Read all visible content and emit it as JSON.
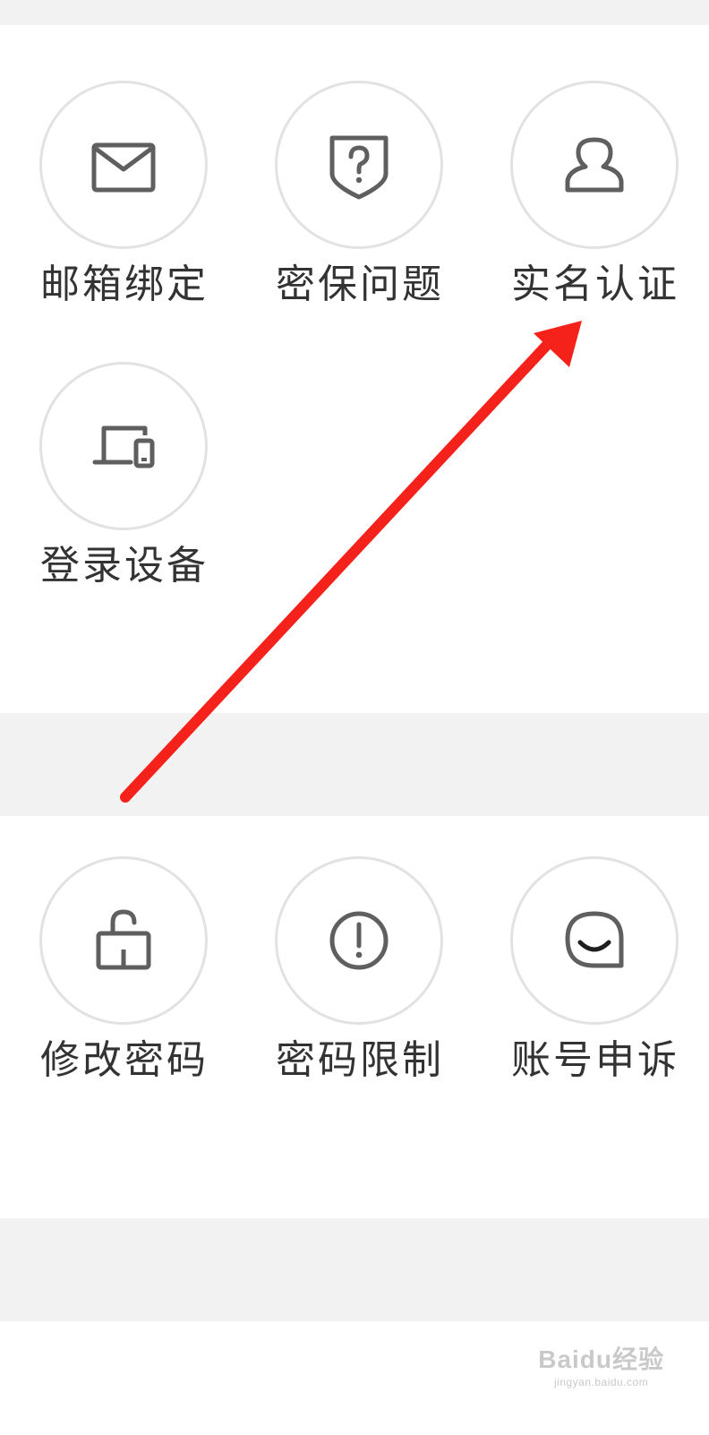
{
  "security_items": [
    {
      "label": "邮箱绑定",
      "icon": "mail-icon"
    },
    {
      "label": "密保问题",
      "icon": "shield-question-icon"
    },
    {
      "label": "实名认证",
      "icon": "user-icon"
    },
    {
      "label": "登录设备",
      "icon": "devices-icon"
    }
  ],
  "password_items": [
    {
      "label": "修改密码",
      "icon": "unlock-icon"
    },
    {
      "label": "密码限制",
      "icon": "exclamation-circle-icon"
    },
    {
      "label": "账号申诉",
      "icon": "chat-smile-icon"
    }
  ],
  "annotation": {
    "arrow_color": "#f5221b",
    "points_to": "实名认证"
  },
  "colors": {
    "icon": "#5f5f5f",
    "circle_border": "#e2e2e2",
    "label": "#333333",
    "band": "#f2f2f2"
  },
  "watermark": {
    "main": "Baidu经验",
    "sub": "jingyan.baidu.com"
  }
}
